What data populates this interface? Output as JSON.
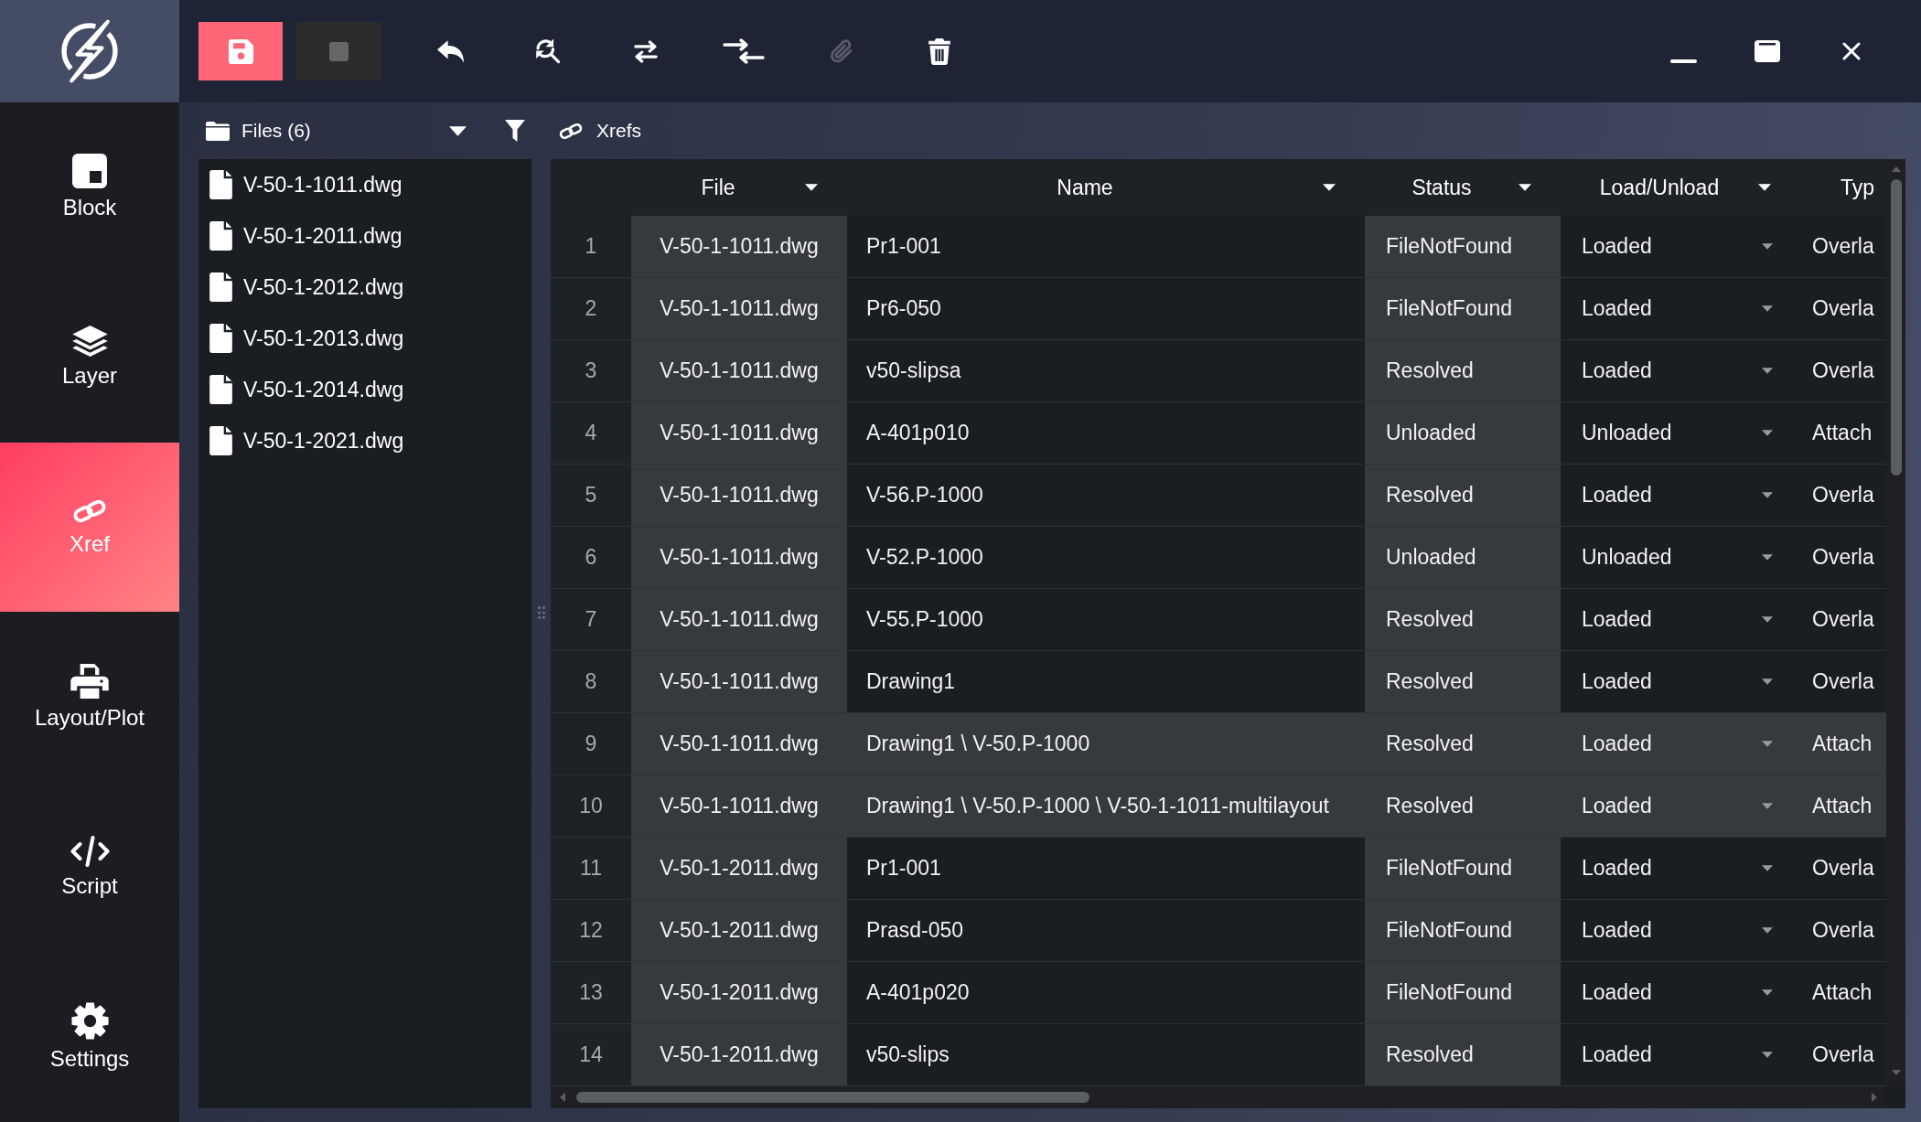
{
  "toolbar": {
    "buttons": [
      {
        "kind": "primary",
        "disabled": false
      },
      {
        "kind": "tile",
        "disabled": true
      },
      {
        "kind": "plain",
        "disabled": false
      },
      {
        "kind": "plain",
        "disabled": false
      },
      {
        "kind": "plain",
        "disabled": false
      },
      {
        "kind": "plain",
        "disabled": false
      },
      {
        "kind": "plain",
        "disabled": true
      },
      {
        "kind": "plain",
        "disabled": false
      }
    ]
  },
  "sidebar": {
    "items": [
      {
        "label": "Block",
        "selected": false
      },
      {
        "label": "Layer",
        "selected": false
      },
      {
        "label": "Xref",
        "selected": true
      },
      {
        "label": "Layout/Plot",
        "selected": false
      },
      {
        "label": "Script",
        "selected": false
      },
      {
        "label": "Settings",
        "selected": false
      }
    ]
  },
  "files_panel": {
    "title": "Files (6)",
    "files": [
      "V-50-1-1011.dwg",
      "V-50-1-2011.dwg",
      "V-50-1-2012.dwg",
      "V-50-1-2013.dwg",
      "V-50-1-2014.dwg",
      "V-50-1-2021.dwg"
    ]
  },
  "xrefs_panel": {
    "title": "Xrefs",
    "table": {
      "columns": [
        {
          "label": "File",
          "dropdown": true
        },
        {
          "label": "Name",
          "dropdown": true
        },
        {
          "label": "Status",
          "dropdown": true
        },
        {
          "label": "Load/Unload",
          "dropdown": true
        },
        {
          "label": "Typ",
          "dropdown": false
        }
      ],
      "rows": [
        {
          "number": "1",
          "file": "V-50-1-1011.dwg",
          "name": "Pr1-001",
          "status": "FileNotFound",
          "load_unload": "Loaded",
          "column_6": "Overla",
          "selected": false
        },
        {
          "number": "2",
          "file": "V-50-1-1011.dwg",
          "name": "Pr6-050",
          "status": "FileNotFound",
          "load_unload": "Loaded",
          "column_6": "Overla",
          "selected": false
        },
        {
          "number": "3",
          "file": "V-50-1-1011.dwg",
          "name": "v50-slipsa",
          "status": "Resolved",
          "load_unload": "Loaded",
          "column_6": "Overla",
          "selected": false
        },
        {
          "number": "4",
          "file": "V-50-1-1011.dwg",
          "name": "A-401p010",
          "status": "Unloaded",
          "load_unload": "Unloaded",
          "column_6": "Attach",
          "selected": false
        },
        {
          "number": "5",
          "file": "V-50-1-1011.dwg",
          "name": "V-56.P-1000",
          "status": "Resolved",
          "load_unload": "Loaded",
          "column_6": "Overla",
          "selected": false
        },
        {
          "number": "6",
          "file": "V-50-1-1011.dwg",
          "name": "V-52.P-1000",
          "status": "Unloaded",
          "load_unload": "Unloaded",
          "column_6": "Overla",
          "selected": false
        },
        {
          "number": "7",
          "file": "V-50-1-1011.dwg",
          "name": "V-55.P-1000",
          "status": "Resolved",
          "load_unload": "Loaded",
          "column_6": "Overla",
          "selected": false
        },
        {
          "number": "8",
          "file": "V-50-1-1011.dwg",
          "name": "Drawing1",
          "status": "Resolved",
          "load_unload": "Loaded",
          "column_6": "Overla",
          "selected": false
        },
        {
          "number": "9",
          "file": "V-50-1-1011.dwg",
          "name": "Drawing1 \\ V-50.P-1000",
          "status": "Resolved",
          "load_unload": "Loaded",
          "column_6": "Attach",
          "selected": true
        },
        {
          "number": "10",
          "file": "V-50-1-1011.dwg",
          "name": "Drawing1 \\ V-50.P-1000 \\ V-50-1-1011-multilayout",
          "status": "Resolved",
          "load_unload": "Loaded",
          "column_6": "Attach",
          "selected": true
        },
        {
          "number": "11",
          "file": "V-50-1-2011.dwg",
          "name": "Pr1-001",
          "status": "FileNotFound",
          "load_unload": "Loaded",
          "column_6": "Overla",
          "selected": false
        },
        {
          "number": "12",
          "file": "V-50-1-2011.dwg",
          "name": "Prasd-050",
          "status": "FileNotFound",
          "load_unload": "Loaded",
          "column_6": "Overla",
          "selected": false
        },
        {
          "number": "13",
          "file": "V-50-1-2011.dwg",
          "name": "A-401p020",
          "status": "FileNotFound",
          "load_unload": "Loaded",
          "column_6": "Attach",
          "selected": false
        },
        {
          "number": "14",
          "file": "V-50-1-2011.dwg",
          "name": "v50-slips",
          "status": "Resolved",
          "load_unload": "Loaded",
          "column_6": "Overla",
          "selected": false
        }
      ]
    }
  }
}
